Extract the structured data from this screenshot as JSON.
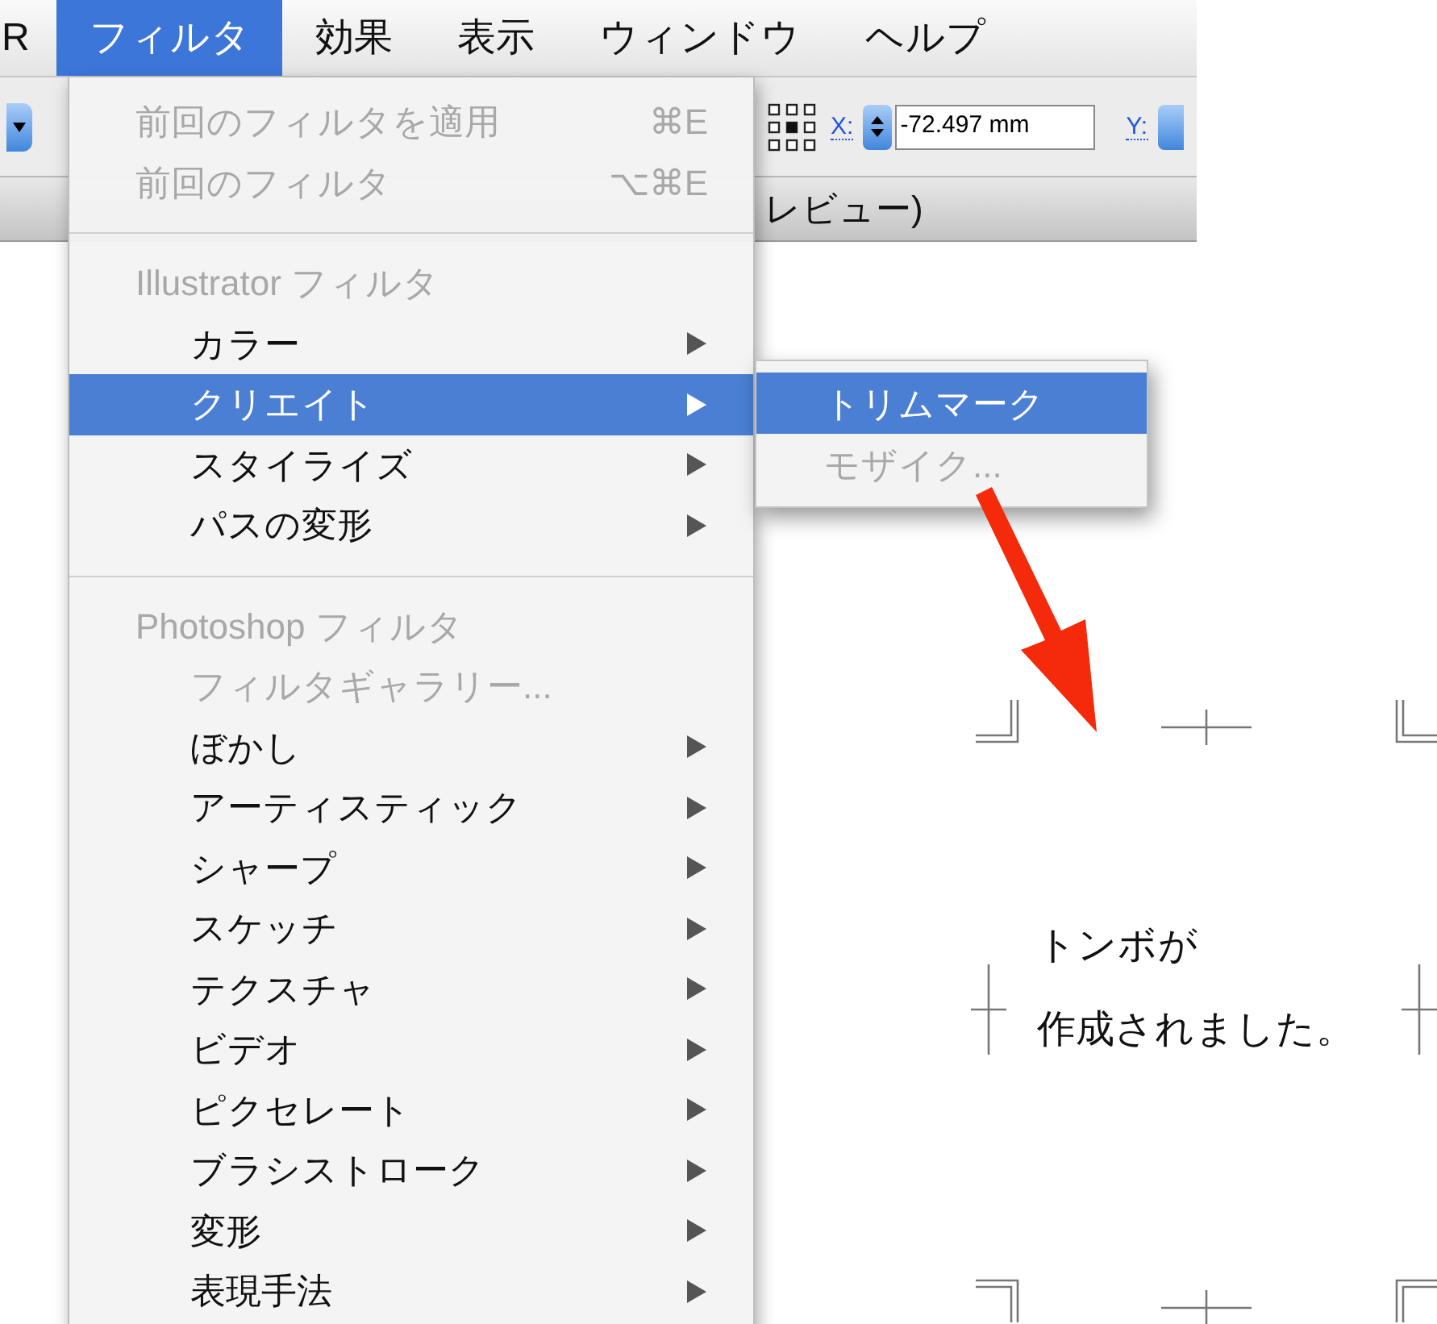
{
  "menubar": {
    "items": [
      {
        "label": "R",
        "selected": false
      },
      {
        "label": "フィルタ",
        "selected": true
      },
      {
        "label": "効果",
        "selected": false
      },
      {
        "label": "表示",
        "selected": false
      },
      {
        "label": "ウィンドウ",
        "selected": false
      },
      {
        "label": "ヘルプ",
        "selected": false
      }
    ]
  },
  "toolbar": {
    "x_label": "X:",
    "x_value": "-72.497 mm",
    "y_label": "Y:"
  },
  "document_title": "レビュー)",
  "filter_menu": {
    "items": [
      {
        "kind": "item",
        "label": "前回のフィルタを適用",
        "shortcut": "⌘E",
        "disabled": true,
        "selected": false,
        "submenu": false
      },
      {
        "kind": "item",
        "label": "前回のフィルタ",
        "shortcut": "⌥⌘E",
        "disabled": true,
        "selected": false,
        "submenu": false
      },
      {
        "kind": "separator"
      },
      {
        "kind": "header",
        "label": "Illustrator フィルタ",
        "children": [
          {
            "kind": "item",
            "label": "カラー",
            "disabled": false,
            "selected": false,
            "submenu": true
          },
          {
            "kind": "item",
            "label": "クリエイト",
            "disabled": false,
            "selected": true,
            "submenu": true
          },
          {
            "kind": "item",
            "label": "スタイライズ",
            "disabled": false,
            "selected": false,
            "submenu": true
          },
          {
            "kind": "item",
            "label": "パスの変形",
            "disabled": false,
            "selected": false,
            "submenu": true
          }
        ]
      },
      {
        "kind": "separator"
      },
      {
        "kind": "header",
        "label": "Photoshop フィルタ",
        "children": [
          {
            "kind": "item",
            "label": "フィルタギャラリー...",
            "disabled": true,
            "selected": false,
            "submenu": false
          },
          {
            "kind": "item",
            "label": "ぼかし",
            "disabled": false,
            "selected": false,
            "submenu": true
          },
          {
            "kind": "item",
            "label": "アーティスティック",
            "disabled": false,
            "selected": false,
            "submenu": true
          },
          {
            "kind": "item",
            "label": "シャープ",
            "disabled": false,
            "selected": false,
            "submenu": true
          },
          {
            "kind": "item",
            "label": "スケッチ",
            "disabled": false,
            "selected": false,
            "submenu": true
          },
          {
            "kind": "item",
            "label": "テクスチャ",
            "disabled": false,
            "selected": false,
            "submenu": true
          },
          {
            "kind": "item",
            "label": "ビデオ",
            "disabled": false,
            "selected": false,
            "submenu": true
          },
          {
            "kind": "item",
            "label": "ピクセレート",
            "disabled": false,
            "selected": false,
            "submenu": true
          },
          {
            "kind": "item",
            "label": "ブラシストローク",
            "disabled": false,
            "selected": false,
            "submenu": true
          },
          {
            "kind": "item",
            "label": "変形",
            "disabled": false,
            "selected": false,
            "submenu": true
          },
          {
            "kind": "item",
            "label": "表現手法",
            "disabled": false,
            "selected": false,
            "submenu": true
          }
        ]
      }
    ]
  },
  "submenu": {
    "items": [
      {
        "label": "トリムマーク",
        "disabled": false,
        "selected": true
      },
      {
        "label": "モザイク...",
        "disabled": true,
        "selected": false
      }
    ]
  },
  "canvas": {
    "lines": [
      "トンボが",
      "作成されました。"
    ]
  }
}
